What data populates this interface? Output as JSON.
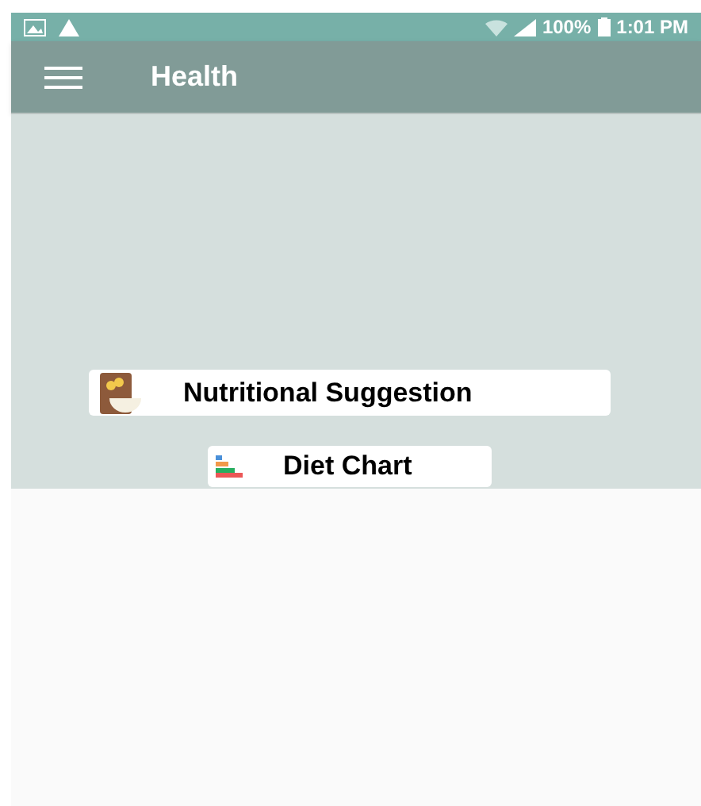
{
  "status_bar": {
    "battery": "100%",
    "time": "1:01 PM"
  },
  "app_bar": {
    "title": "Health"
  },
  "buttons": [
    {
      "label": "Nutritional Suggestion",
      "kind": "nutrition"
    },
    {
      "label": "Diet Chart",
      "kind": "chart"
    }
  ]
}
